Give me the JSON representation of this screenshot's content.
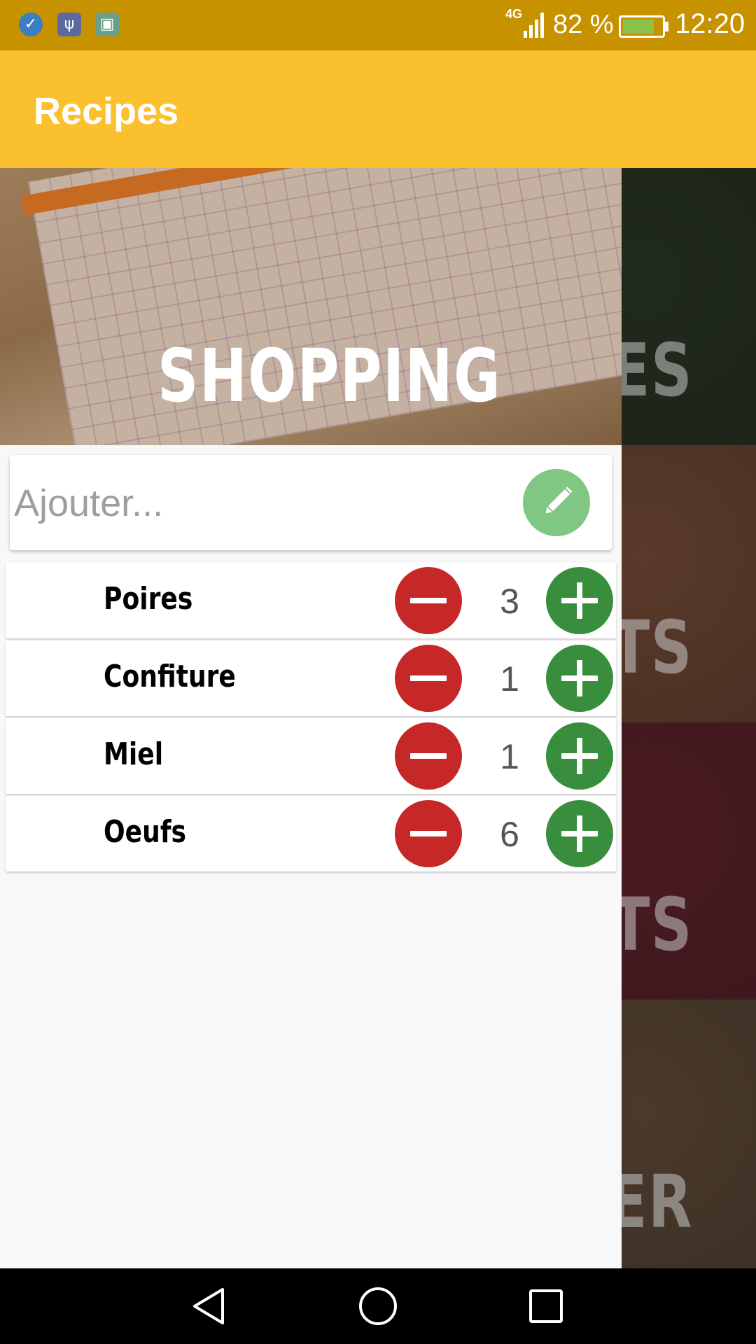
{
  "status_bar": {
    "network": "4G",
    "battery_percent": "82 %",
    "battery_level": 0.82,
    "time": "12:20",
    "icons": [
      "check-notification-icon",
      "usb-icon",
      "image-notification-icon",
      "signal-icon",
      "battery-charging-icon"
    ]
  },
  "app_bar": {
    "title": "Recipes"
  },
  "background_cards": [
    {
      "label": "ES",
      "color": "#1f2a1c"
    },
    {
      "label": "TS",
      "color": "#5a3a2a"
    },
    {
      "label": "TS",
      "color": "#4a1a22"
    },
    {
      "label": "ER",
      "color": "#4a3a2c"
    }
  ],
  "drawer": {
    "hero_title": "SHOPPING",
    "add_input": {
      "placeholder": "Ajouter...",
      "value": ""
    },
    "items": [
      {
        "name": "Poires",
        "quantity": "3"
      },
      {
        "name": "Confiture",
        "quantity": "1"
      },
      {
        "name": "Miel",
        "quantity": "1"
      },
      {
        "name": "Oeufs",
        "quantity": "6"
      }
    ]
  },
  "colors": {
    "status_bar": "#c69200",
    "app_bar": "#fbc02d",
    "minus": "#c62828",
    "plus": "#388e3c",
    "edit": "#81c784"
  }
}
